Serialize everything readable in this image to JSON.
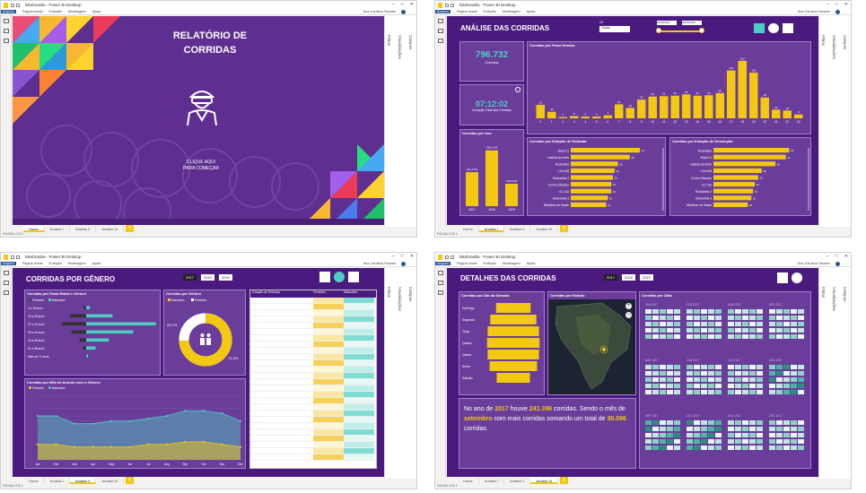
{
  "common": {
    "app_title": "bikebrasilia - Power BI Desktop",
    "menu": [
      "Arquivo",
      "Página Inicial",
      "Exibição",
      "Modelagem",
      "Ajuda"
    ],
    "user": "Ana Carolina Tavares",
    "tabs": [
      "Home",
      "Analise I",
      "Analise II",
      "Analise III"
    ],
    "pane_viz": "Visualizações",
    "pane_fields": "Campos",
    "pane_filters": "Filtros"
  },
  "w1": {
    "title": "RELATÓRIO DE CORRIDAS",
    "cta_line1": "CLIQUE AQUI",
    "cta_line2": "PARA COMEÇAR",
    "status": "PÁGINA 1 DE 4"
  },
  "w2": {
    "title": "ANÁLISE DAS CORRIDAS",
    "uf_label": "UF",
    "uf_value": "Todas",
    "date_from": "25/06/2017",
    "date_to": "30/06/2019",
    "kpi_rides_value": "796.732",
    "kpi_rides_label": "Corridas",
    "kpi_dur_value": "07:12:02",
    "kpi_dur_label": "Duração Total das Corridas",
    "card_hour": "Corridas por Faixa Horária",
    "card_year": "Corridas por Ano",
    "card_pickup": "Corridas por Estação de Retirada",
    "card_dropoff": "Corridas por Estação de Devolução",
    "status": "PÁGINA 2 DE 4"
  },
  "w3": {
    "title": "CORRIDAS POR GÊNERO",
    "years": [
      "2017",
      "2018",
      "2019"
    ],
    "card_age": "Corridas por Faixa Etária e Gênero",
    "card_gender": "Corridas por Gênero",
    "card_month": "Corridas por Mês de Acordo com o Gênero",
    "leg_f": "Feminino",
    "leg_m": "Masculino",
    "gender_pct_f": "25,7%",
    "gender_pct_m": "74,3%",
    "table_header": "Estação de Retirada",
    "table_cols": [
      "Feminino",
      "Masculino"
    ],
    "status": "PÁGINA 3 DE 4"
  },
  "w4": {
    "title": "DETALHES DAS CORRIDAS",
    "years": [
      "2017",
      "2018",
      "2019"
    ],
    "card_weekday": "Corridas por Dia da Semana",
    "card_state": "Corridas por Estado",
    "card_date": "Corridas por Data",
    "days": [
      "Domingo",
      "Segunda",
      "Terça",
      "Quarta",
      "Quinta",
      "Sexta",
      "Sábado"
    ],
    "months": [
      "JAN 2017",
      "FEB 2017",
      "MAR 2017",
      "APR 2017",
      "MAY 2017",
      "JUN 2017",
      "JUL 2017",
      "AUG 2017",
      "SEP 2017",
      "OCT 2017",
      "NOV 2017",
      "DEC 2017"
    ],
    "story_p1": "No ano de ",
    "story_year": "2017",
    "story_p2": " houve ",
    "story_total": "241.396",
    "story_p3": " corridas. Sendo o mês de ",
    "story_month": "setembro",
    "story_p4": " com mais corridas somando um total de ",
    "story_month_total": "30.096",
    "story_p5": " corridas.",
    "status": "PÁGINA 4 DE 4"
  },
  "chart_data": [
    {
      "type": "bar",
      "title": "Corridas por Faixa Horária",
      "categories": [
        "0",
        "1",
        "2",
        "3",
        "4",
        "5",
        "6",
        "7",
        "8",
        "9",
        "10",
        "11",
        "12",
        "13",
        "14",
        "15",
        "16",
        "17",
        "18",
        "19",
        "20",
        "21",
        "22",
        "23"
      ],
      "values": [
        31,
        15,
        3,
        5,
        4,
        4,
        7,
        32,
        24,
        43,
        50,
        51,
        52,
        55,
        52,
        53,
        58,
        110,
        132,
        105,
        48,
        20,
        18,
        9
      ],
      "data_labels": [
        "31",
        "15",
        "3",
        "5",
        "4",
        "4",
        "7",
        "32",
        "24",
        "43",
        "50",
        "51",
        "52",
        "55",
        "52",
        "53",
        "58",
        "110",
        "132",
        "105",
        "48",
        "20",
        "18",
        "9"
      ]
    },
    {
      "type": "bar",
      "title": "Corridas por Ano",
      "categories": [
        "2017",
        "2018",
        "2019"
      ],
      "values": [
        241.4,
        396.3,
        159.0
      ],
      "data_labels": [
        "241,4 Mil",
        "396,3 Mil",
        "159,0 Mil"
      ]
    },
    {
      "type": "bar",
      "title": "Corridas por Estação de Retirada",
      "categories": [
        "Brasil 21",
        "Instituto de Artes",
        "Rodoviária",
        "CLN 408",
        "Rodoviária 2",
        "Centro Olímpico",
        "ICC Sul",
        "Rodoviária 3",
        "Ministério da Saúde"
      ],
      "values": [
        41,
        35,
        28,
        26,
        25,
        24,
        24,
        22,
        21
      ]
    },
    {
      "type": "bar",
      "title": "Corridas por Estação de Devolução",
      "categories": [
        "Rodoviária",
        "Brasil 21",
        "Instituto de Artes",
        "CLN 408",
        "Centro Olímpico",
        "ICC Sul",
        "Rodoviária 2",
        "Rodoviária 3",
        "Ministério da Saúde"
      ],
      "values": [
        44,
        42,
        36,
        28,
        26,
        24,
        23,
        22,
        20
      ]
    },
    {
      "type": "pie",
      "title": "Corridas por Gênero",
      "categories": [
        "Masculino",
        "Feminino"
      ],
      "values": [
        74.3,
        25.7
      ]
    },
    {
      "type": "area",
      "title": "Corridas por Mês de Acordo com o Gênero",
      "categories": [
        "Jan",
        "Feb",
        "Mar",
        "Apr",
        "May",
        "Jun",
        "Jul",
        "Aug",
        "Sep",
        "Oct",
        "Nov",
        "Dec"
      ],
      "series": [
        {
          "name": "Masculino",
          "values": [
            17,
            17,
            14,
            14,
            15,
            15,
            16,
            17,
            19,
            19,
            18,
            15
          ]
        },
        {
          "name": "Feminino",
          "values": [
            6,
            6,
            5,
            5,
            5,
            5,
            6,
            6,
            7,
            7,
            6,
            5
          ]
        }
      ],
      "ylim": [
        0,
        25
      ]
    },
    {
      "type": "bar",
      "title": "Corridas por Faixa Etária e Gênero",
      "categories": [
        "0 a 18 anos",
        "19 a 26 anos",
        "27 a 34 anos",
        "35 a 42 anos",
        "43 a 50 anos",
        "51 a 58 anos",
        "Mais de 71 anos"
      ],
      "series": [
        {
          "name": "Feminino",
          "values": [
            3,
            20,
            30,
            18,
            8,
            4,
            1
          ]
        },
        {
          "name": "Masculino",
          "values": [
            4,
            28,
            74,
            50,
            24,
            10,
            2
          ]
        }
      ]
    },
    {
      "type": "bar",
      "title": "Corridas por Dia da Semana",
      "categories": [
        "Domingo",
        "Segunda",
        "Terça",
        "Quarta",
        "Quinta",
        "Sexta",
        "Sábado"
      ],
      "values": [
        27,
        36,
        40,
        41,
        40,
        37,
        26
      ]
    }
  ]
}
